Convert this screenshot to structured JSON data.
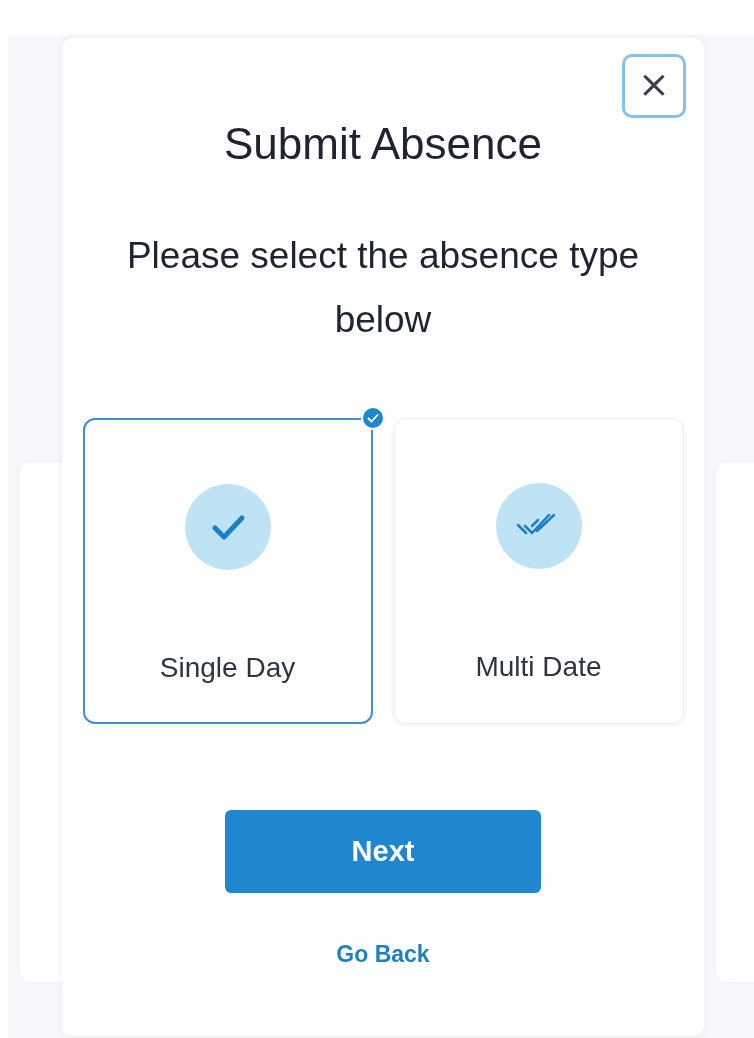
{
  "dialog": {
    "title": "Submit Absence",
    "subtitle": "Please select the absence type below",
    "close": "×"
  },
  "options": [
    {
      "kind": "single",
      "label": "Single Day",
      "selected": true
    },
    {
      "kind": "multi",
      "label": "Multi Date",
      "selected": false
    }
  ],
  "next_button": "Next",
  "back_link": "Go Back"
}
